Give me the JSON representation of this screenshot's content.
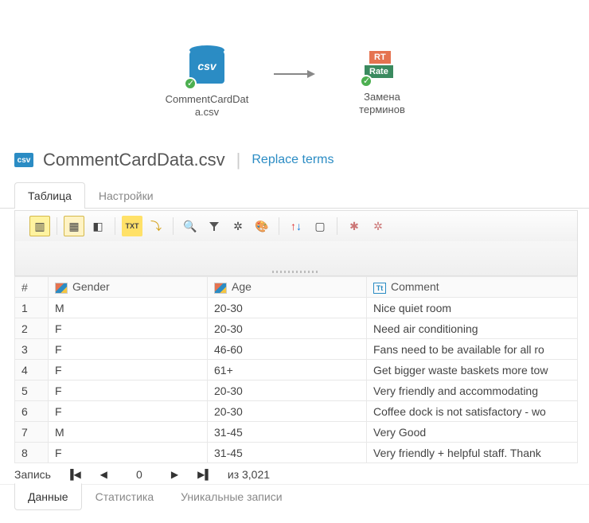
{
  "workflow": {
    "node1_label": "CommentCardDat\na.csv",
    "node2_label": "Замена\nтерминов"
  },
  "title": {
    "main": "CommentCardData.csv",
    "sub": "Replace terms"
  },
  "tabs_top": [
    {
      "label": "Таблица",
      "active": true
    },
    {
      "label": "Настройки",
      "active": false
    }
  ],
  "toolbar_icons": [
    "columns-icon",
    "highlight-icon",
    "splitter-icon",
    "txt-icon",
    "sort-icon",
    "binoculars-icon",
    "filter-icon",
    "gear-icon",
    "palette-icon",
    "reorder-icon",
    "page-icon",
    "spark1-icon",
    "spark2-icon"
  ],
  "table": {
    "headers": [
      "#",
      "Gender",
      "Age",
      "Comment"
    ],
    "rows": [
      {
        "n": "1",
        "gender": "M",
        "age": "20-30",
        "comment": "Nice quiet room"
      },
      {
        "n": "2",
        "gender": "F",
        "age": "20-30",
        "comment": "Need air conditioning"
      },
      {
        "n": "3",
        "gender": "F",
        "age": "46-60",
        "comment": "Fans need to be available for all ro"
      },
      {
        "n": "4",
        "gender": "F",
        "age": "61+",
        "comment": "Get bigger waste baskets more tow"
      },
      {
        "n": "5",
        "gender": "F",
        "age": "20-30",
        "comment": "Very friendly and accommodating"
      },
      {
        "n": "6",
        "gender": "F",
        "age": "20-30",
        "comment": "Coffee dock is not satisfactory - wo"
      },
      {
        "n": "7",
        "gender": "M",
        "age": "31-45",
        "comment": "Very Good"
      },
      {
        "n": "8",
        "gender": "F",
        "age": "31-45",
        "comment": "Very friendly + helpful staff. Thank"
      }
    ]
  },
  "record_nav": {
    "label": "Запись",
    "position": "0",
    "total": "из 3,021"
  },
  "tabs_bottom": [
    {
      "label": "Данные",
      "active": true
    },
    {
      "label": "Статистика",
      "active": false
    },
    {
      "label": "Уникальные записи",
      "active": false
    }
  ]
}
